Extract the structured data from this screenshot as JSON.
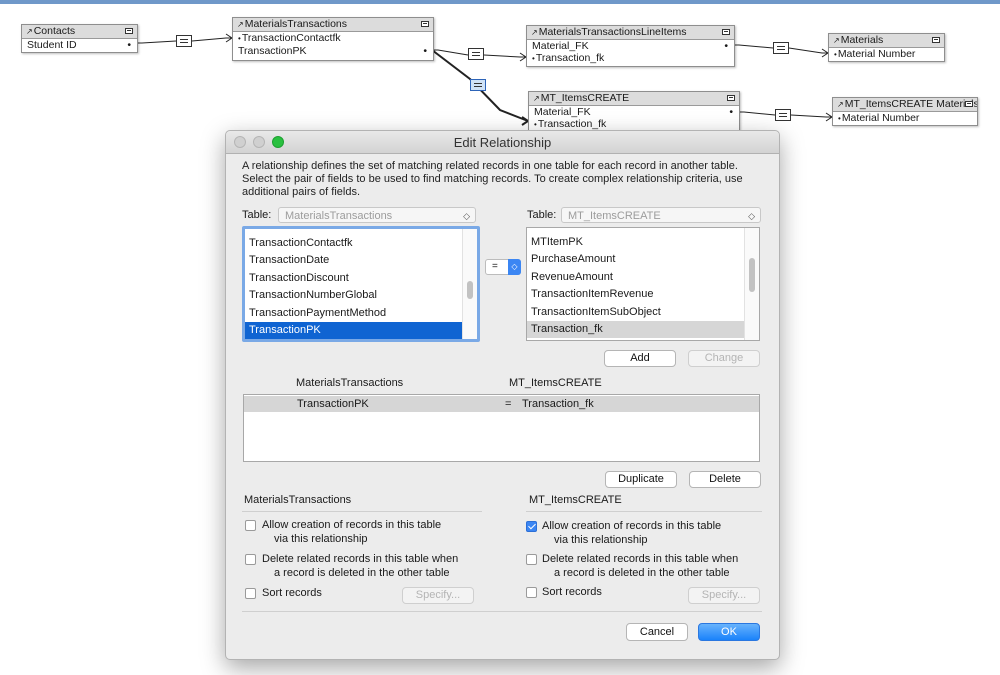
{
  "graph": {
    "tables": {
      "contacts": {
        "name": "Contacts",
        "fields": [
          "Student ID"
        ]
      },
      "materials_transactions": {
        "name": "MaterialsTransactions",
        "fields": [
          "TransactionContactfk",
          "TransactionPK"
        ]
      },
      "line_items": {
        "name": "MaterialsTransactionsLineItems",
        "fields": [
          "Material_FK",
          "Transaction_fk"
        ]
      },
      "materials": {
        "name": "Materials",
        "fields": [
          "Material Number"
        ]
      },
      "mt_items_create": {
        "name": "MT_ItemsCREATE",
        "fields": [
          "Material_FK",
          "Transaction_fk"
        ]
      },
      "mt_items_create_materials": {
        "name": "MT_ItemsCREATE Materials",
        "fields": [
          "Material Number"
        ]
      }
    }
  },
  "dialog": {
    "title": "Edit Relationship",
    "description": "A relationship defines the set of matching related records in one table for each record in another table. Select the pair of fields to be used to find matching records. To create complex relationship criteria, use additional pairs of fields.",
    "left": {
      "table_label": "Table:",
      "table_value": "MaterialsTransactions",
      "fields": [
        "TransactionContactfk",
        "TransactionDate",
        "TransactionDiscount",
        "TransactionNumberGlobal",
        "TransactionPaymentMethod",
        "TransactionPK"
      ],
      "selected": "TransactionPK"
    },
    "operator": "=",
    "right": {
      "table_label": "Table:",
      "table_value": "MT_ItemsCREATE",
      "fields": [
        "MTItemPK",
        "PurchaseAmount",
        "RevenueAmount",
        "TransactionItemRevenue",
        "TransactionItemSubObject",
        "Transaction_fk"
      ],
      "selected": "Transaction_fk"
    },
    "buttons": {
      "add": "Add",
      "change": "Change",
      "duplicate": "Duplicate",
      "delete": "Delete",
      "cancel": "Cancel",
      "ok": "OK"
    },
    "criteria": {
      "left_header": "MaterialsTransactions",
      "right_header": "MT_ItemsCREATE",
      "rows": [
        {
          "left": "TransactionPK",
          "op": "=",
          "right": "Transaction_fk"
        }
      ]
    },
    "options": {
      "left": {
        "title": "MaterialsTransactions",
        "allow_create": {
          "line1": "Allow creation of records in this table",
          "line2": "via this relationship",
          "checked": false
        },
        "delete_related": {
          "line1": "Delete related records in this table when",
          "line2": "a record is deleted in the other table",
          "checked": false
        },
        "sort": {
          "label": "Sort records",
          "checked": false
        },
        "specify": "Specify..."
      },
      "right": {
        "title": "MT_ItemsCREATE",
        "allow_create": {
          "line1": "Allow creation of records in this table",
          "line2": "via this relationship",
          "checked": true
        },
        "delete_related": {
          "line1": "Delete related records in this table when",
          "line2": "a record is deleted in the other table",
          "checked": false
        },
        "sort": {
          "label": "Sort records",
          "checked": false
        },
        "specify": "Specify..."
      }
    }
  }
}
